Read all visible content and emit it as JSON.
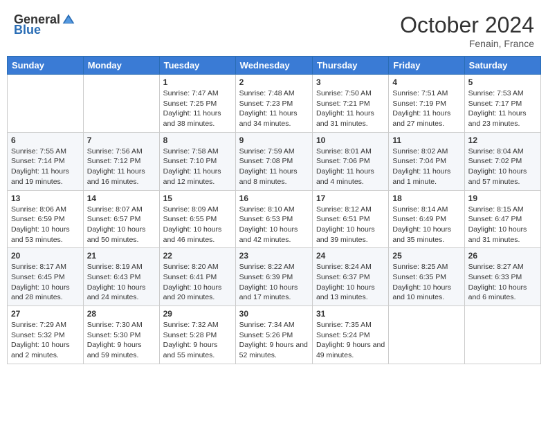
{
  "header": {
    "logo_general": "General",
    "logo_blue": "Blue",
    "month_year": "October 2024",
    "location": "Fenain, France"
  },
  "weekdays": [
    "Sunday",
    "Monday",
    "Tuesday",
    "Wednesday",
    "Thursday",
    "Friday",
    "Saturday"
  ],
  "weeks": [
    [
      {
        "day": "",
        "content": ""
      },
      {
        "day": "",
        "content": ""
      },
      {
        "day": "1",
        "content": "Sunrise: 7:47 AM\nSunset: 7:25 PM\nDaylight: 11 hours and 38 minutes."
      },
      {
        "day": "2",
        "content": "Sunrise: 7:48 AM\nSunset: 7:23 PM\nDaylight: 11 hours and 34 minutes."
      },
      {
        "day": "3",
        "content": "Sunrise: 7:50 AM\nSunset: 7:21 PM\nDaylight: 11 hours and 31 minutes."
      },
      {
        "day": "4",
        "content": "Sunrise: 7:51 AM\nSunset: 7:19 PM\nDaylight: 11 hours and 27 minutes."
      },
      {
        "day": "5",
        "content": "Sunrise: 7:53 AM\nSunset: 7:17 PM\nDaylight: 11 hours and 23 minutes."
      }
    ],
    [
      {
        "day": "6",
        "content": "Sunrise: 7:55 AM\nSunset: 7:14 PM\nDaylight: 11 hours and 19 minutes."
      },
      {
        "day": "7",
        "content": "Sunrise: 7:56 AM\nSunset: 7:12 PM\nDaylight: 11 hours and 16 minutes."
      },
      {
        "day": "8",
        "content": "Sunrise: 7:58 AM\nSunset: 7:10 PM\nDaylight: 11 hours and 12 minutes."
      },
      {
        "day": "9",
        "content": "Sunrise: 7:59 AM\nSunset: 7:08 PM\nDaylight: 11 hours and 8 minutes."
      },
      {
        "day": "10",
        "content": "Sunrise: 8:01 AM\nSunset: 7:06 PM\nDaylight: 11 hours and 4 minutes."
      },
      {
        "day": "11",
        "content": "Sunrise: 8:02 AM\nSunset: 7:04 PM\nDaylight: 11 hours and 1 minute."
      },
      {
        "day": "12",
        "content": "Sunrise: 8:04 AM\nSunset: 7:02 PM\nDaylight: 10 hours and 57 minutes."
      }
    ],
    [
      {
        "day": "13",
        "content": "Sunrise: 8:06 AM\nSunset: 6:59 PM\nDaylight: 10 hours and 53 minutes."
      },
      {
        "day": "14",
        "content": "Sunrise: 8:07 AM\nSunset: 6:57 PM\nDaylight: 10 hours and 50 minutes."
      },
      {
        "day": "15",
        "content": "Sunrise: 8:09 AM\nSunset: 6:55 PM\nDaylight: 10 hours and 46 minutes."
      },
      {
        "day": "16",
        "content": "Sunrise: 8:10 AM\nSunset: 6:53 PM\nDaylight: 10 hours and 42 minutes."
      },
      {
        "day": "17",
        "content": "Sunrise: 8:12 AM\nSunset: 6:51 PM\nDaylight: 10 hours and 39 minutes."
      },
      {
        "day": "18",
        "content": "Sunrise: 8:14 AM\nSunset: 6:49 PM\nDaylight: 10 hours and 35 minutes."
      },
      {
        "day": "19",
        "content": "Sunrise: 8:15 AM\nSunset: 6:47 PM\nDaylight: 10 hours and 31 minutes."
      }
    ],
    [
      {
        "day": "20",
        "content": "Sunrise: 8:17 AM\nSunset: 6:45 PM\nDaylight: 10 hours and 28 minutes."
      },
      {
        "day": "21",
        "content": "Sunrise: 8:19 AM\nSunset: 6:43 PM\nDaylight: 10 hours and 24 minutes."
      },
      {
        "day": "22",
        "content": "Sunrise: 8:20 AM\nSunset: 6:41 PM\nDaylight: 10 hours and 20 minutes."
      },
      {
        "day": "23",
        "content": "Sunrise: 8:22 AM\nSunset: 6:39 PM\nDaylight: 10 hours and 17 minutes."
      },
      {
        "day": "24",
        "content": "Sunrise: 8:24 AM\nSunset: 6:37 PM\nDaylight: 10 hours and 13 minutes."
      },
      {
        "day": "25",
        "content": "Sunrise: 8:25 AM\nSunset: 6:35 PM\nDaylight: 10 hours and 10 minutes."
      },
      {
        "day": "26",
        "content": "Sunrise: 8:27 AM\nSunset: 6:33 PM\nDaylight: 10 hours and 6 minutes."
      }
    ],
    [
      {
        "day": "27",
        "content": "Sunrise: 7:29 AM\nSunset: 5:32 PM\nDaylight: 10 hours and 2 minutes."
      },
      {
        "day": "28",
        "content": "Sunrise: 7:30 AM\nSunset: 5:30 PM\nDaylight: 9 hours and 59 minutes."
      },
      {
        "day": "29",
        "content": "Sunrise: 7:32 AM\nSunset: 5:28 PM\nDaylight: 9 hours and 55 minutes."
      },
      {
        "day": "30",
        "content": "Sunrise: 7:34 AM\nSunset: 5:26 PM\nDaylight: 9 hours and 52 minutes."
      },
      {
        "day": "31",
        "content": "Sunrise: 7:35 AM\nSunset: 5:24 PM\nDaylight: 9 hours and 49 minutes."
      },
      {
        "day": "",
        "content": ""
      },
      {
        "day": "",
        "content": ""
      }
    ]
  ]
}
